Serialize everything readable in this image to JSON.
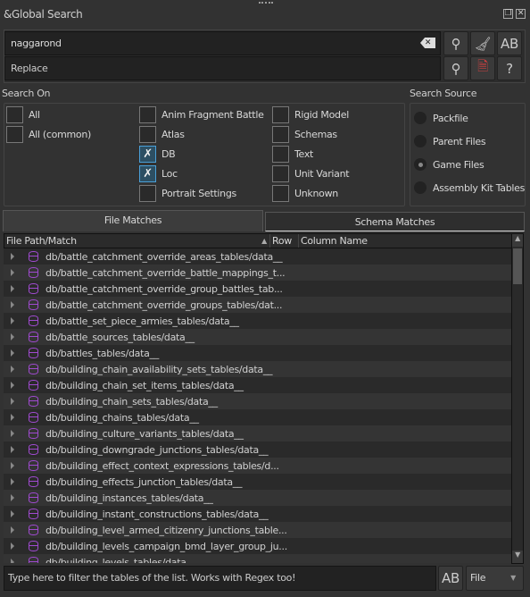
{
  "window": {
    "title": "&Global Search"
  },
  "search": {
    "value": "naggarond",
    "replace_placeholder": "Replace"
  },
  "search_on": {
    "label": "Search On",
    "col1": [
      {
        "label": "All",
        "checked": false
      },
      {
        "label": "All (common)",
        "checked": false
      }
    ],
    "col2": [
      {
        "label": "Anim Fragment Battle",
        "checked": false
      },
      {
        "label": "Atlas",
        "checked": false
      },
      {
        "label": "DB",
        "checked": true
      },
      {
        "label": "Loc",
        "checked": true
      },
      {
        "label": "Portrait Settings",
        "checked": false
      }
    ],
    "col3": [
      {
        "label": "Rigid Model",
        "checked": false
      },
      {
        "label": "Schemas",
        "checked": false
      },
      {
        "label": "Text",
        "checked": false
      },
      {
        "label": "Unit Variant",
        "checked": false
      },
      {
        "label": "Unknown",
        "checked": false
      }
    ]
  },
  "search_source": {
    "label": "Search Source",
    "options": [
      {
        "label": "Packfile",
        "selected": false
      },
      {
        "label": "Parent Files",
        "selected": false
      },
      {
        "label": "Game Files",
        "selected": true
      },
      {
        "label": "Assembly Kit Tables",
        "selected": false
      }
    ]
  },
  "tabs": [
    {
      "label": "File Matches",
      "active": true
    },
    {
      "label": "Schema Matches",
      "active": false
    }
  ],
  "table": {
    "columns": [
      "File Path/Match",
      "Row",
      "Column Name"
    ],
    "rows": [
      "db/battle_catchment_override_areas_tables/data__",
      "db/battle_catchment_override_battle_mappings_t...",
      "db/battle_catchment_override_group_battles_tab...",
      "db/battle_catchment_override_groups_tables/dat...",
      "db/battle_set_piece_armies_tables/data__",
      "db/battle_sources_tables/data__",
      "db/battles_tables/data__",
      "db/building_chain_availability_sets_tables/data__",
      "db/building_chain_set_items_tables/data__",
      "db/building_chain_sets_tables/data__",
      "db/building_chains_tables/data__",
      "db/building_culture_variants_tables/data__",
      "db/building_downgrade_junctions_tables/data__",
      "db/building_effect_context_expressions_tables/d...",
      "db/building_effects_junction_tables/data__",
      "db/building_instances_tables/data__",
      "db/building_instant_constructions_tables/data__",
      "db/building_level_armed_citizenry_junctions_table...",
      "db/building_levels_campaign_bmd_layer_group_ju...",
      "db/building_levels_tables/data__"
    ]
  },
  "filter": {
    "placeholder": "Type here to filter the tables of the list. Works with Regex too!",
    "mode": "File"
  },
  "colors": {
    "db_icon": "#a04ad0",
    "accent": "#4aa0d8",
    "clear_icon": "#d04040"
  }
}
